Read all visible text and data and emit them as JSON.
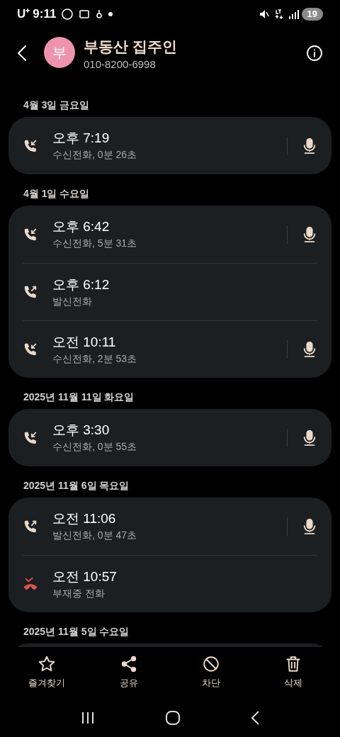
{
  "status_bar": {
    "carrier": "U⁺",
    "time": "9:11",
    "battery": "19"
  },
  "contact": {
    "avatar": "부",
    "name": "부동산 집주인",
    "number": "010-8200-6998"
  },
  "groups": [
    {
      "date": "4월 3일 금요일",
      "calls": [
        {
          "kind": "incoming",
          "time": "오후 7:19",
          "detail": "수신전화, 0분 26초",
          "recorded": true
        }
      ]
    },
    {
      "date": "4월 1일 수요일",
      "calls": [
        {
          "kind": "incoming",
          "time": "오후 6:42",
          "detail": "수신전화, 5분 31초",
          "recorded": true
        },
        {
          "kind": "outgoing",
          "time": "오후 6:12",
          "detail": "발신전화",
          "recorded": false
        },
        {
          "kind": "incoming",
          "time": "오전 10:11",
          "detail": "수신전화, 2분 53초",
          "recorded": true
        }
      ]
    },
    {
      "date": "2025년 11월 11일 화요일",
      "calls": [
        {
          "kind": "incoming",
          "time": "오후 3:30",
          "detail": "수신전화, 0분 55초",
          "recorded": true
        }
      ]
    },
    {
      "date": "2025년 11월 6일 목요일",
      "calls": [
        {
          "kind": "outgoing",
          "time": "오전 11:06",
          "detail": "발신전화, 0분 47초",
          "recorded": true
        },
        {
          "kind": "missed",
          "time": "오전 10:57",
          "detail": "부재중 전화",
          "recorded": false
        }
      ]
    },
    {
      "date": "2025년 11월 5일 수요일"
    }
  ],
  "actions": [
    {
      "kind": "star",
      "label": "즐겨찾기"
    },
    {
      "kind": "share",
      "label": "공유"
    },
    {
      "kind": "block",
      "label": "차단"
    },
    {
      "kind": "delete",
      "label": "삭제"
    }
  ]
}
